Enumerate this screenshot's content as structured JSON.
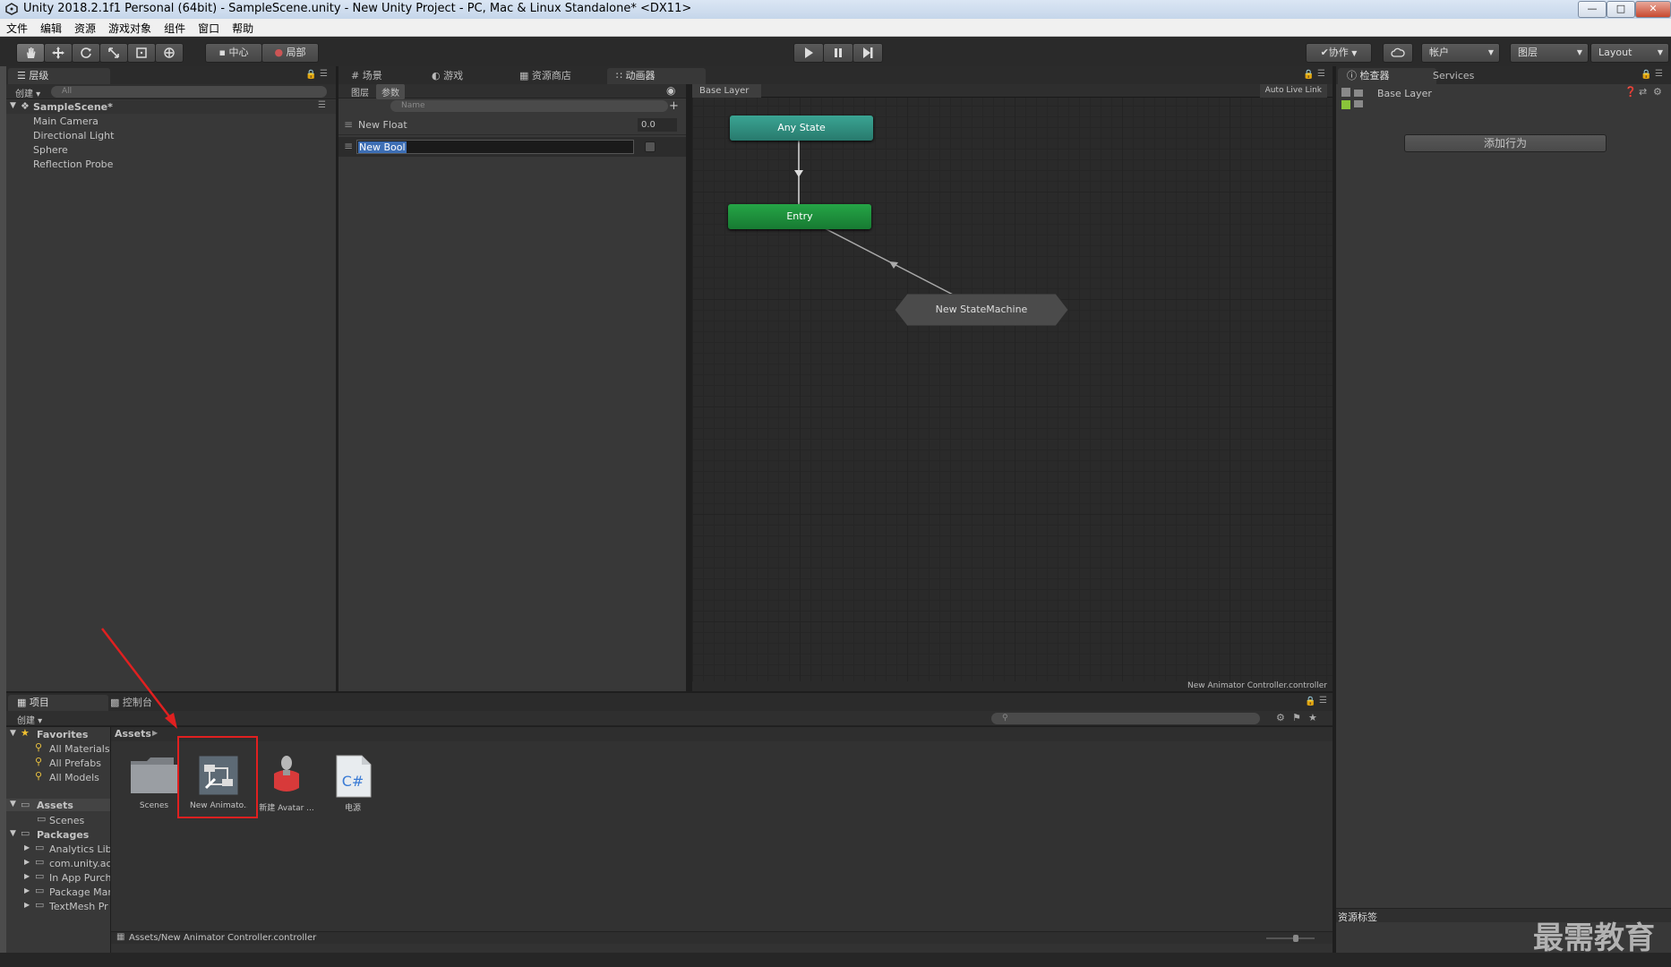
{
  "window": {
    "title": "Unity 2018.2.1f1 Personal (64bit) - SampleScene.unity - New Unity Project - PC, Mac & Linux Standalone* <DX11>"
  },
  "menu": [
    "文件",
    "编辑",
    "资源",
    "游戏对象",
    "组件",
    "窗口",
    "帮助"
  ],
  "toolbar": {
    "pivot": "中心",
    "local": "局部",
    "collab": "协作",
    "account": "帐户",
    "layers": "图层",
    "layout": "Layout"
  },
  "hierarchy": {
    "tab": "层级",
    "create": "创建",
    "search_placeholder": "All",
    "scene": "SampleScene*",
    "items": [
      "Main Camera",
      "Directional Light",
      "Sphere",
      "Reflection Probe"
    ]
  },
  "center_tabs": [
    "场景",
    "游戏",
    "资源商店",
    "动画器"
  ],
  "animator": {
    "layers_tab": "图层",
    "params_tab": "参数",
    "search_placeholder": "Name",
    "params": [
      {
        "name": "New Float",
        "value": "0.0"
      },
      {
        "name": "New Bool",
        "value": ""
      }
    ],
    "breadcrumb": "Base Layer",
    "auto_live_link": "Auto Live Link",
    "nodes": {
      "any_state": "Any State",
      "entry": "Entry",
      "sub_state_machine": "New StateMachine"
    },
    "footer": "New Animator Controller.controller"
  },
  "inspector": {
    "tab": "检查器",
    "services_tab": "Services",
    "layer_name": "Base Layer",
    "add_behaviour": "添加行为",
    "asset_labels": "资源标签"
  },
  "project": {
    "tab": "项目",
    "console_tab": "控制台",
    "create": "创建",
    "favorites": "Favorites",
    "favorite_items": [
      "All Materials",
      "All Prefabs",
      "All Models"
    ],
    "assets_header": "Assets",
    "assets_children": [
      "Scenes"
    ],
    "packages_header": "Packages",
    "package_items": [
      "Analytics Lib",
      "com.unity.ac",
      "In App Purch",
      "Package Mar",
      "TextMesh Pr"
    ],
    "breadcrumb": "Assets",
    "assets": [
      {
        "name": "Scenes",
        "icon": "folder-icon"
      },
      {
        "name": "New Animato...",
        "icon": "animator-controller-icon"
      },
      {
        "name": "新建 Avatar ...",
        "icon": "avatar-mask-icon"
      },
      {
        "name": "电源",
        "icon": "csharp-script-icon"
      }
    ],
    "status_path": "Assets/New Animator Controller.controller"
  },
  "watermark": "最需教育",
  "colors": {
    "any_state": "#2f8a7c",
    "entry": "#1e8f3a",
    "highlight": "#e02020",
    "selection": "#3d6eb4"
  }
}
